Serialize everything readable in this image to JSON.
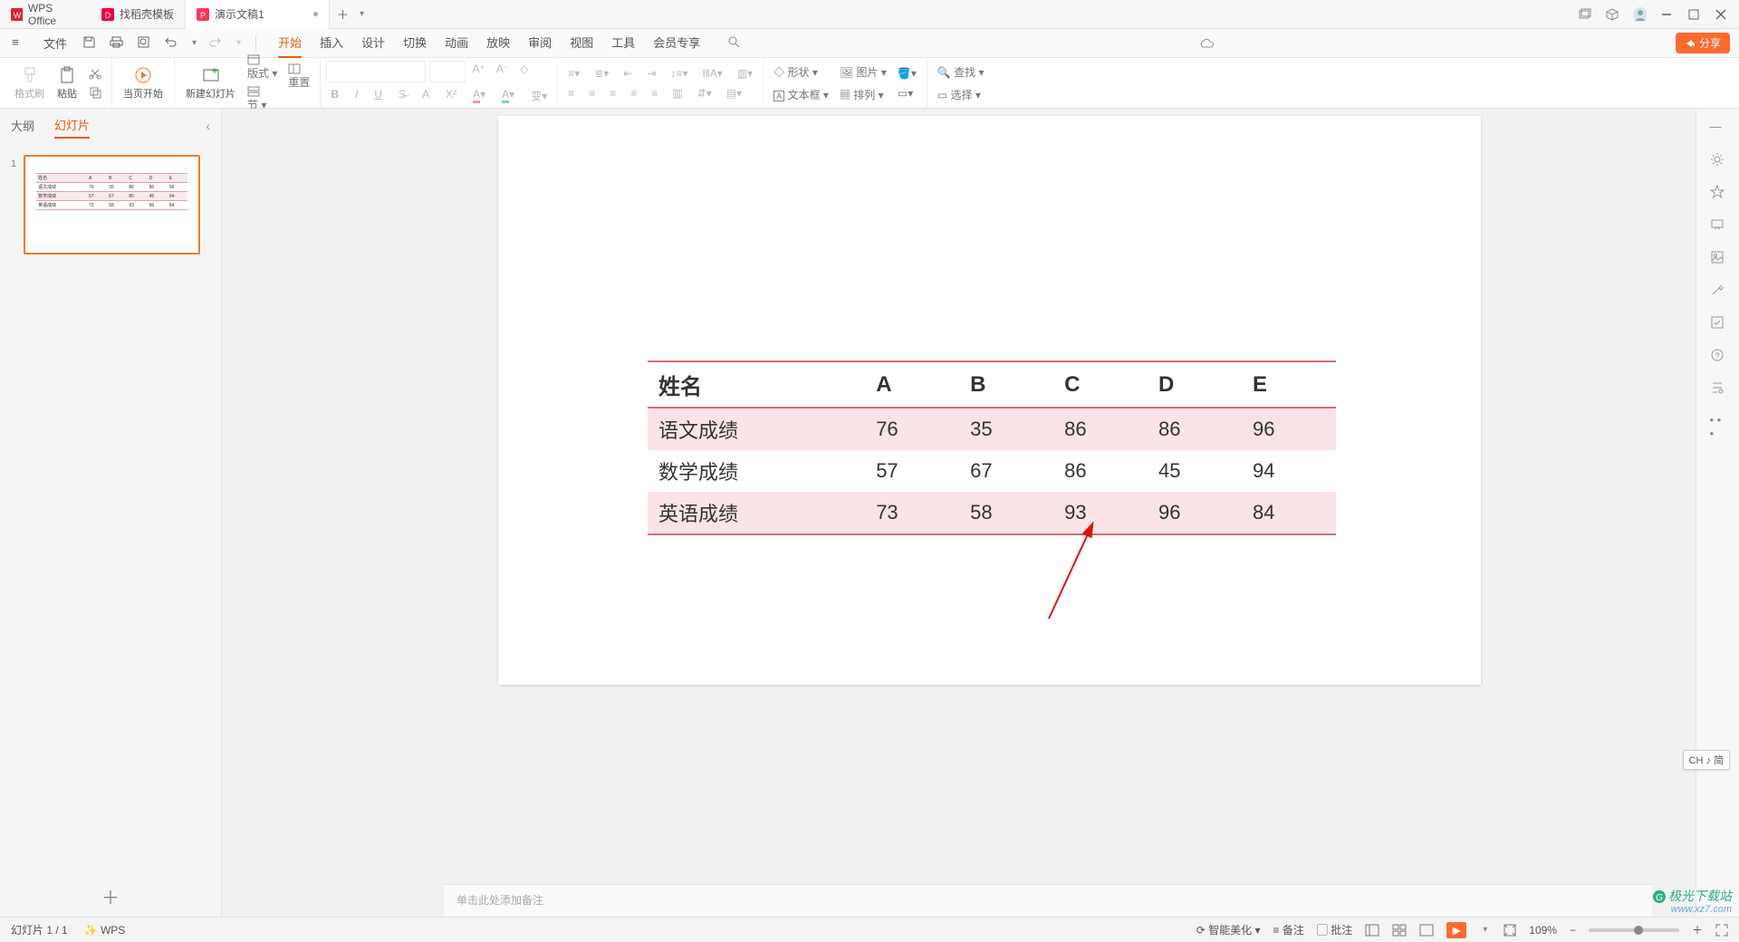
{
  "title_tabs": {
    "wps": "WPS Office",
    "template": "找稻壳模板",
    "doc": "演示文稿1"
  },
  "file_label": "文件",
  "menu": [
    "开始",
    "插入",
    "设计",
    "切换",
    "动画",
    "放映",
    "审阅",
    "视图",
    "工具",
    "会员专享"
  ],
  "share": "分享",
  "ribbon": {
    "format_brush": "格式刷",
    "paste": "粘贴",
    "from_current": "当页开始",
    "new_slide": "新建幻灯片",
    "layout": "版式",
    "reset": "重置",
    "section": "节",
    "shape": "形状",
    "picture": "图片",
    "textbox": "文本框",
    "arrange": "排列",
    "find": "查找",
    "select": "选择"
  },
  "side": {
    "outline": "大纲",
    "slides": "幻灯片",
    "num": "1"
  },
  "notes_placeholder": "单击此处添加备注",
  "table": {
    "headers": [
      "姓名",
      "A",
      "B",
      "C",
      "D",
      "E"
    ],
    "rows": [
      [
        "语文成绩",
        "76",
        "35",
        "86",
        "86",
        "96"
      ],
      [
        "数学成绩",
        "57",
        "67",
        "86",
        "45",
        "94"
      ],
      [
        "英语成绩",
        "73",
        "58",
        "93",
        "96",
        "84"
      ]
    ]
  },
  "status": {
    "slide_counter": "幻灯片 1 / 1",
    "wps_label": "WPS",
    "beautify": "智能美化",
    "remarks": "备注",
    "comments": "批注",
    "zoom": "109%"
  },
  "ime": "CH ♪ 简",
  "watermark": {
    "brand": "极光下载站",
    "url": "www.xz7.com"
  },
  "chart_data": {
    "type": "table",
    "title": "",
    "categories": [
      "A",
      "B",
      "C",
      "D",
      "E"
    ],
    "series": [
      {
        "name": "语文成绩",
        "values": [
          76,
          35,
          86,
          86,
          96
        ]
      },
      {
        "name": "数学成绩",
        "values": [
          57,
          67,
          86,
          45,
          94
        ]
      },
      {
        "name": "英语成绩",
        "values": [
          73,
          58,
          93,
          96,
          84
        ]
      }
    ]
  }
}
